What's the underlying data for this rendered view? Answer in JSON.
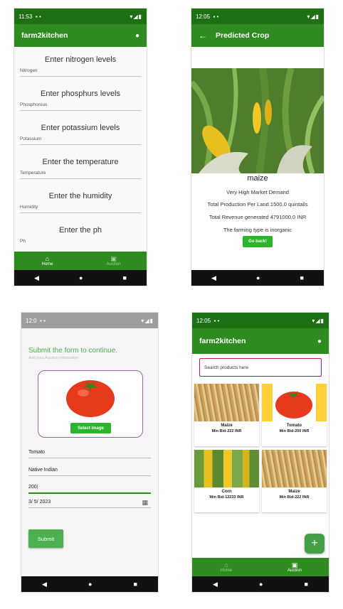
{
  "screen1": {
    "status_time": "11:53",
    "app_title": "farm2kitchen",
    "fields": [
      {
        "header": "Enter nitrogen levels",
        "label": "Nitrogen"
      },
      {
        "header": "Enter phosphurs levels",
        "label": "Phosphorous"
      },
      {
        "header": "Enter potassium levels",
        "label": "Potassium"
      },
      {
        "header": "Enter the temperature",
        "label": "Temperature"
      },
      {
        "header": "Enter the humidity",
        "label": "Humidity"
      },
      {
        "header": "Enter the ph",
        "label": "Ph"
      }
    ],
    "nav": {
      "home": "Home",
      "auction": "Auction"
    }
  },
  "screen2": {
    "status_time": "12:05",
    "app_title": "Predicted Crop",
    "crop_name": "maize",
    "lines": [
      "Very High Market Demand",
      "Total Production Per Land 1500.0 quintails",
      "Total Revenue generated 4791000.0 INR",
      "The farming type is inorganic"
    ],
    "back_button": "Go back!"
  },
  "screen3": {
    "status_time": "12:0",
    "form_title": "Submit the form to continue.",
    "form_subtitle": "Add your Auction information",
    "select_image": "Select Image",
    "inputs": [
      "Tomato",
      "Native Indian",
      "200",
      "3/ 5/ 2023"
    ],
    "submit": "Submit"
  },
  "screen4": {
    "status_time": "12:05",
    "app_title": "farm2kitchen",
    "search_placeholder": "Search products here",
    "products": [
      {
        "name": "Maize",
        "bid": "Min Bid-222 INR",
        "image": "wheat"
      },
      {
        "name": "Tomato",
        "bid": "Min Bid-200 INR",
        "image": "tomato"
      },
      {
        "name": "Corn",
        "bid": "Min Bid-12233 INR",
        "image": "corn"
      },
      {
        "name": "Maize",
        "bid": "Min Bid-222 INR",
        "image": "wheat"
      }
    ],
    "nav": {
      "home": "Home",
      "auction": "Auction"
    }
  },
  "colors": {
    "appbar": "#2e8b1f",
    "statusbar": "#1f6f14",
    "button": "#2bb52b",
    "accent_text": "#4caf50"
  }
}
